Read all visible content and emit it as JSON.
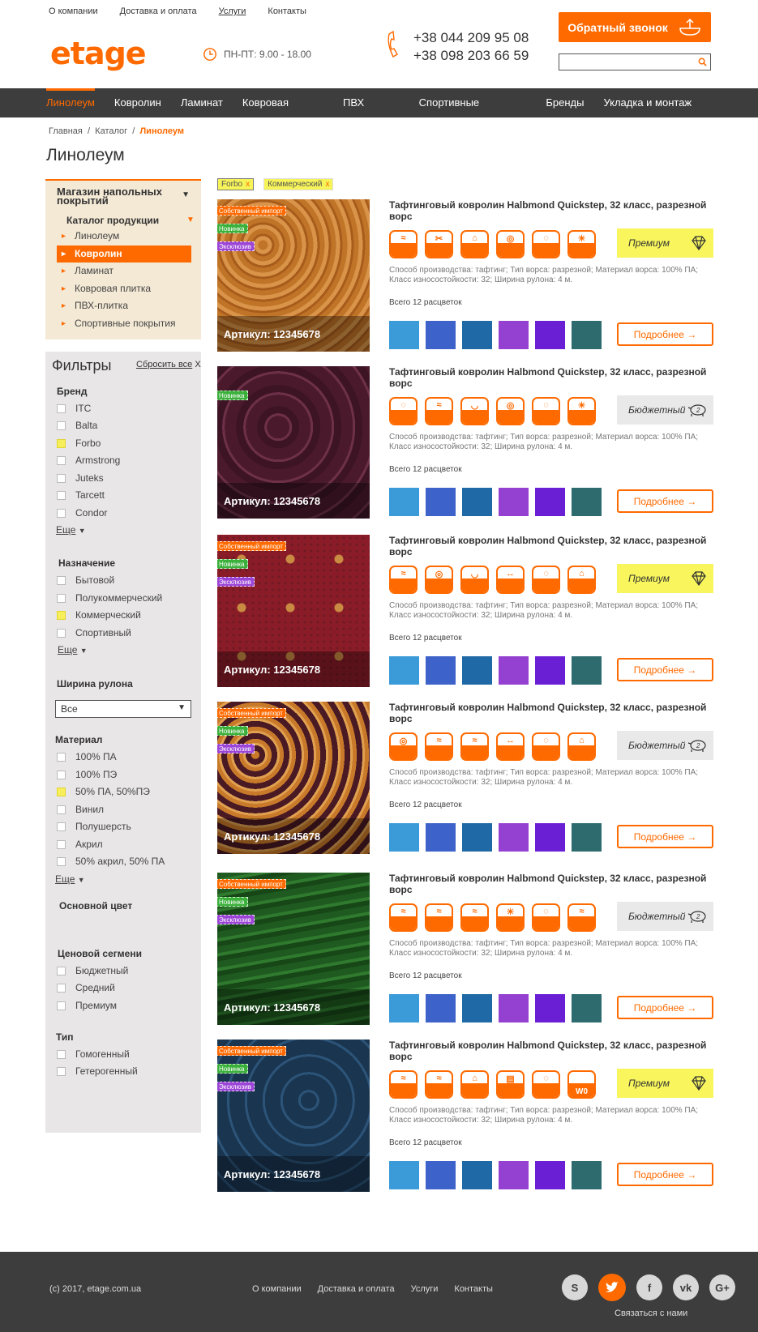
{
  "top_nav": {
    "items": [
      "О компании",
      "Доставка и оплата",
      "Услуги",
      "Контакты"
    ]
  },
  "logo": "etage",
  "work_hours": "ПН-ПТ: 9.00 - 18.00",
  "phones": [
    "+38 044 209 95 08",
    "+38 098 203 66 59"
  ],
  "callback_label": "Обратный звонок",
  "search": {
    "placeholder": "",
    "value": ""
  },
  "main_nav": {
    "items": [
      "Линолеум",
      "Ковролин",
      "Ламинат",
      "Ковровая плитка",
      "ПВХ плитка",
      "Спортивные покрытия",
      "Бренды",
      "Укладка и монтаж покрытий"
    ],
    "active": "Линолеум"
  },
  "breadcrumb": {
    "items": [
      "Главная",
      "Каталог"
    ],
    "current": "Линолеум"
  },
  "page_title": "Линолеум",
  "catalog": {
    "header": "Магазин напольных покрытий",
    "sub": "Каталог продукции",
    "links": [
      "Линолеум",
      "Ковролин",
      "Ламинат",
      "Ковровая плитка",
      "ПВХ-плитка",
      "Спортивные покрытия"
    ],
    "active": "Ковролин"
  },
  "filters": {
    "title": "Фильтры",
    "reset": "Сбросить все",
    "reset_x": "X",
    "brand": {
      "title": "Бренд",
      "items": [
        "ITC",
        "Balta",
        "Forbo",
        "Armstrong",
        "Juteks",
        "Tarcett",
        "Condor"
      ],
      "checked": [
        "Forbo"
      ],
      "more": "Еще"
    },
    "purpose": {
      "title": "Назначение",
      "items": [
        "Бытовой",
        "Полукоммерческий",
        "Коммерческий",
        "Спортивный"
      ],
      "checked": [
        "Коммерческий"
      ],
      "more": "Еще"
    },
    "width": {
      "title": "Ширина рулона",
      "value": "Все"
    },
    "material": {
      "title": "Материал",
      "items": [
        "100% ПА",
        "100% ПЭ",
        "50% ПА, 50%ПЭ",
        "Винил",
        "Полушерсть",
        "Акрил",
        "50% акрил, 50% ПА"
      ],
      "checked": [
        "50% ПА, 50%ПЭ"
      ],
      "more": "Еще"
    },
    "color": {
      "title": "Основной цвет"
    },
    "price": {
      "title": "Ценовой сегмени",
      "items": [
        "Бюджетный",
        "Средний",
        "Премиум"
      ]
    },
    "type": {
      "title": "Тип",
      "items": [
        "Гомогенный",
        "Гетерогенный"
      ]
    }
  },
  "active_tags": [
    {
      "label": "Forbo",
      "x": "x"
    },
    {
      "label": "Коммерческий",
      "x": "x"
    }
  ],
  "badges": {
    "import": "Собственный импорт",
    "new": "Новинка",
    "exclusive": "Эксклюзив"
  },
  "product_common": {
    "title": "Тафтинговый ковролин Halbmond Quickstep, 32 класс, разрезной ворс",
    "desc": "Способ производства: тафтинг; Тип ворса: разрезной; Материал ворса: 100% ПА; Класс износостойкости: 32; Ширина рулона: 4 м.",
    "count": "Всего 12 расцветок",
    "more": "Подробнее →",
    "article": "Артикул: 12345678"
  },
  "products": [
    {
      "segment": "Премиум",
      "type": "prem",
      "badges": [
        "import",
        "new",
        "exclusive"
      ],
      "pattern": "orange"
    },
    {
      "segment": "Бюджетный",
      "type": "bud",
      "badges": [
        "new"
      ],
      "pattern": "plum"
    },
    {
      "segment": "Премиум",
      "type": "prem",
      "badges": [
        "import",
        "new",
        "exclusive"
      ],
      "pattern": "red"
    },
    {
      "segment": "Бюджетный",
      "type": "bud",
      "badges": [
        "import",
        "new",
        "exclusive"
      ],
      "pattern": "baroque"
    },
    {
      "segment": "Бюджетный",
      "type": "bud",
      "badges": [
        "import",
        "new",
        "exclusive"
      ],
      "pattern": "green"
    },
    {
      "segment": "Премиум",
      "type": "prem",
      "badges": [
        "import",
        "new",
        "exclusive"
      ],
      "pattern": "navy"
    }
  ],
  "swatch_colors": [
    "#3b9ad8",
    "#3d62c9",
    "#1f6aa6",
    "#9440d0",
    "#6a1fd4",
    "#2d6b6e"
  ],
  "footer": {
    "copyright": "(c) 2017, etage.com.ua",
    "links": [
      "О компании",
      "Доставка и оплата",
      "Услуги",
      "Контакты"
    ],
    "social_icons": [
      "skype-icon",
      "twitter-icon",
      "facebook-icon",
      "vk-icon",
      "google-plus-icon"
    ],
    "contact": "Связаться с нами"
  },
  "colors": {
    "accent": "#ff6a00",
    "dark": "#3d3d3d",
    "premium": "#f8f65c"
  }
}
